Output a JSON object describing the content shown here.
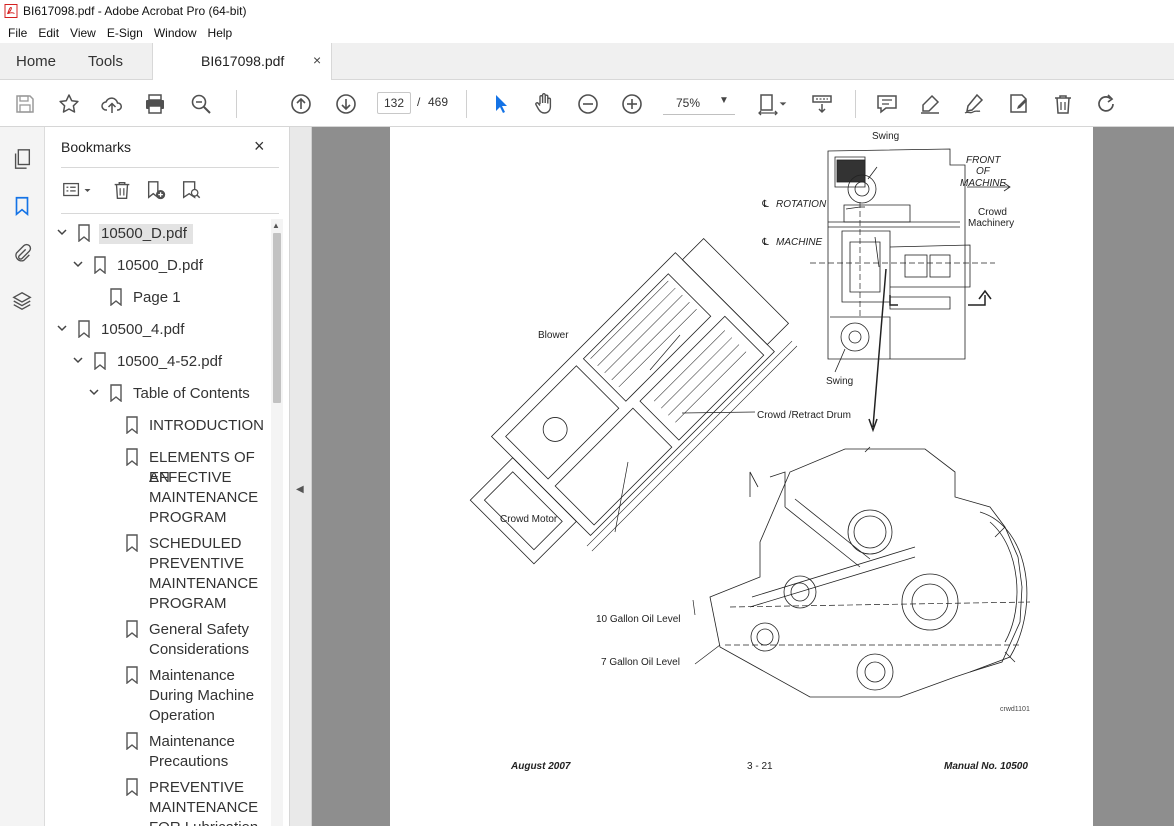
{
  "window": {
    "title": "BI617098.pdf - Adobe Acrobat Pro (64-bit)"
  },
  "menu": [
    "File",
    "Edit",
    "View",
    "E-Sign",
    "Window",
    "Help"
  ],
  "tabs": {
    "home": "Home",
    "tools": "Tools",
    "document": "BI617098.pdf",
    "close": "×"
  },
  "toolbar": {
    "current_page": "132",
    "separator": "/",
    "total_pages": "469",
    "zoom": "75%"
  },
  "bookmarks": {
    "title": "Bookmarks",
    "close": "×",
    "items": [
      {
        "label": "10500_D.pdf",
        "level": 0,
        "expanded": true,
        "selected": true
      },
      {
        "label": "10500_D.pdf",
        "level": 1,
        "expanded": true
      },
      {
        "label": "Page 1",
        "level": 2
      },
      {
        "label": "10500_4.pdf",
        "level": 0,
        "expanded": true
      },
      {
        "label": "10500_4-52.pdf",
        "level": 1,
        "expanded": true
      },
      {
        "label": "Table of Contents",
        "level": 2,
        "expanded": true
      },
      {
        "label": "INTRODUCTION",
        "level": 3
      },
      {
        "label": [
          "ELEMENTS OF AN",
          "EFFECTIVE",
          "MAINTENANCE",
          "PROGRAM"
        ],
        "level": 3
      },
      {
        "label": [
          "SCHEDULED",
          "PREVENTIVE",
          "MAINTENANCE",
          "PROGRAM"
        ],
        "level": 3
      },
      {
        "label": [
          "General Safety",
          "Considerations"
        ],
        "level": 3
      },
      {
        "label": [
          "Maintenance",
          "During Machine",
          "Operation"
        ],
        "level": 3
      },
      {
        "label": [
          "Maintenance",
          "Precautions"
        ],
        "level": 3
      },
      {
        "label": [
          "PREVENTIVE",
          "MAINTENANCE",
          "FOR Lubrication"
        ],
        "level": 3
      }
    ]
  },
  "document": {
    "labels": {
      "swing_top": "Swing",
      "front_of_machine": [
        "FRONT",
        "OF",
        "MACHINE"
      ],
      "rotation": "ROTATION",
      "machine": "MACHINE",
      "crowd_machinery": [
        "Crowd",
        "Machinery"
      ],
      "blower": "Blower",
      "swing_bottom": "Swing",
      "crowd_retract_drum": "Crowd /Retract Drum",
      "crowd_motor": "Crowd Motor",
      "ten_gallon": "10 Gallon Oil Level",
      "seven_gallon": "7 Gallon Oil Level",
      "drawing_id": "crwd1101"
    },
    "footer": {
      "date": "August 2007",
      "page": "3 - 21",
      "manual": "Manual No. 10500"
    }
  },
  "colors": {
    "accent_blue": "#1473e6",
    "icon_gray": "#505050",
    "doc_bg": "#8e8e8e"
  }
}
